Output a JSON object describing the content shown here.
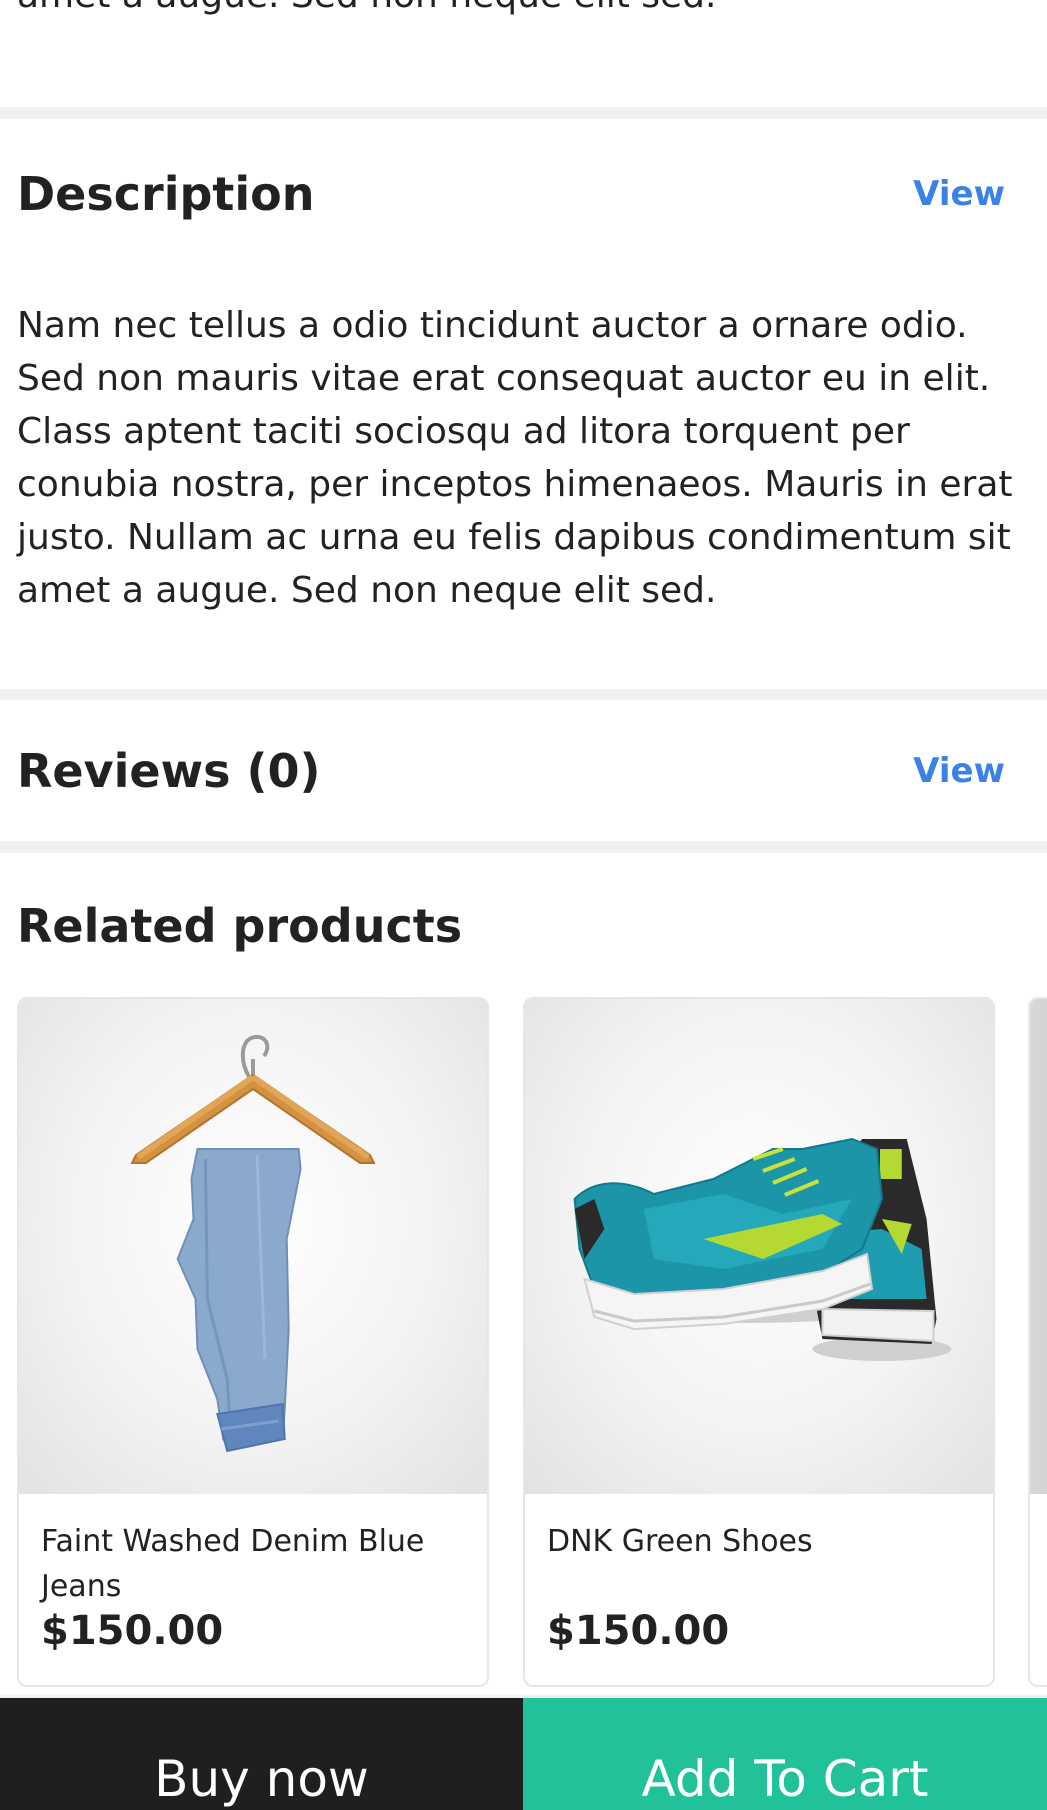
{
  "top_section": {
    "clipped_text": "amet a augue. Sed non neque elit sed."
  },
  "description": {
    "title": "Description",
    "view_label": "View",
    "body": "Nam nec tellus a odio tincidunt auctor a ornare odio. Sed non mauris vitae erat consequat auctor eu in elit. Class aptent taciti sociosqu ad litora torquent per conubia nostra, per inceptos himenaeos. Mauris in erat justo. Nullam ac urna eu felis dapibus condimentum sit amet a augue. Sed non neque elit sed."
  },
  "reviews": {
    "title": "Reviews (0)",
    "view_label": "View"
  },
  "related": {
    "title": "Related products",
    "products": [
      {
        "name": "Faint Washed Denim Blue Jeans",
        "price": "$150.00",
        "image_icon": "jeans-on-hanger-image"
      },
      {
        "name": "DNK Green Shoes",
        "price": "$150.00",
        "image_icon": "green-shoes-image"
      }
    ]
  },
  "bottom_bar": {
    "buy_now_label": "Buy now",
    "add_to_cart_label": "Add To Cart"
  },
  "colors": {
    "link_blue": "#3b82e6",
    "add_to_cart_green": "#21c199",
    "buy_now_dark": "#1f1f1f"
  }
}
